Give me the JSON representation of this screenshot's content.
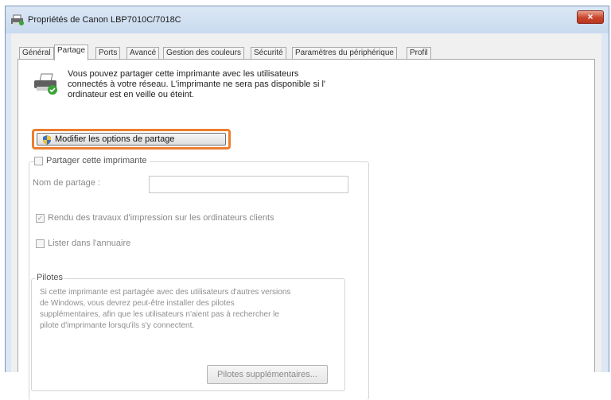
{
  "window": {
    "title": "Propriétés de Canon LBP7010C/7018C",
    "close_glyph": "×"
  },
  "tabs": [
    {
      "label": "Général",
      "active": false
    },
    {
      "label": "Partage",
      "active": true
    },
    {
      "label": "Ports",
      "active": false
    },
    {
      "label": "Avancé",
      "active": false
    },
    {
      "label": "Gestion des couleurs",
      "active": false
    },
    {
      "label": "Sécurité",
      "active": false
    },
    {
      "label": "Paramètres du périphérique",
      "active": false
    },
    {
      "label": "Profil",
      "active": false
    }
  ],
  "sharing": {
    "intro_line1": "Vous pouvez partager cette imprimante avec les utilisateurs",
    "intro_line2": "connectés à votre réseau. L'imprimante ne sera pas disponible si l'",
    "intro_line3": "ordinateur est en veille ou éteint.",
    "change_options_button": "Modifier les options de partage",
    "share_checkbox_label": "Partager cette imprimante",
    "share_name_label": "Nom de partage :",
    "share_name_value": "",
    "render_jobs_label": "Rendu des travaux d'impression sur les ordinateurs clients",
    "list_directory_label": "Lister dans l'annuaire"
  },
  "drivers": {
    "legend": "Pilotes",
    "text_line1": "Si cette imprimante est partagée avec des utilisateurs d'autres versions",
    "text_line2": "de Windows, vous devrez peut-être installer des pilotes",
    "text_line3": "supplémentaires, afin que les utilisateurs n'aient pas à rechercher le",
    "text_line4": "pilote d'imprimante lorsqu'ils s'y connectent.",
    "additional_drivers_button": "Pilotes supplémentaires..."
  },
  "colors": {
    "highlight": "#ed7d2e",
    "close": "#c8452d"
  }
}
